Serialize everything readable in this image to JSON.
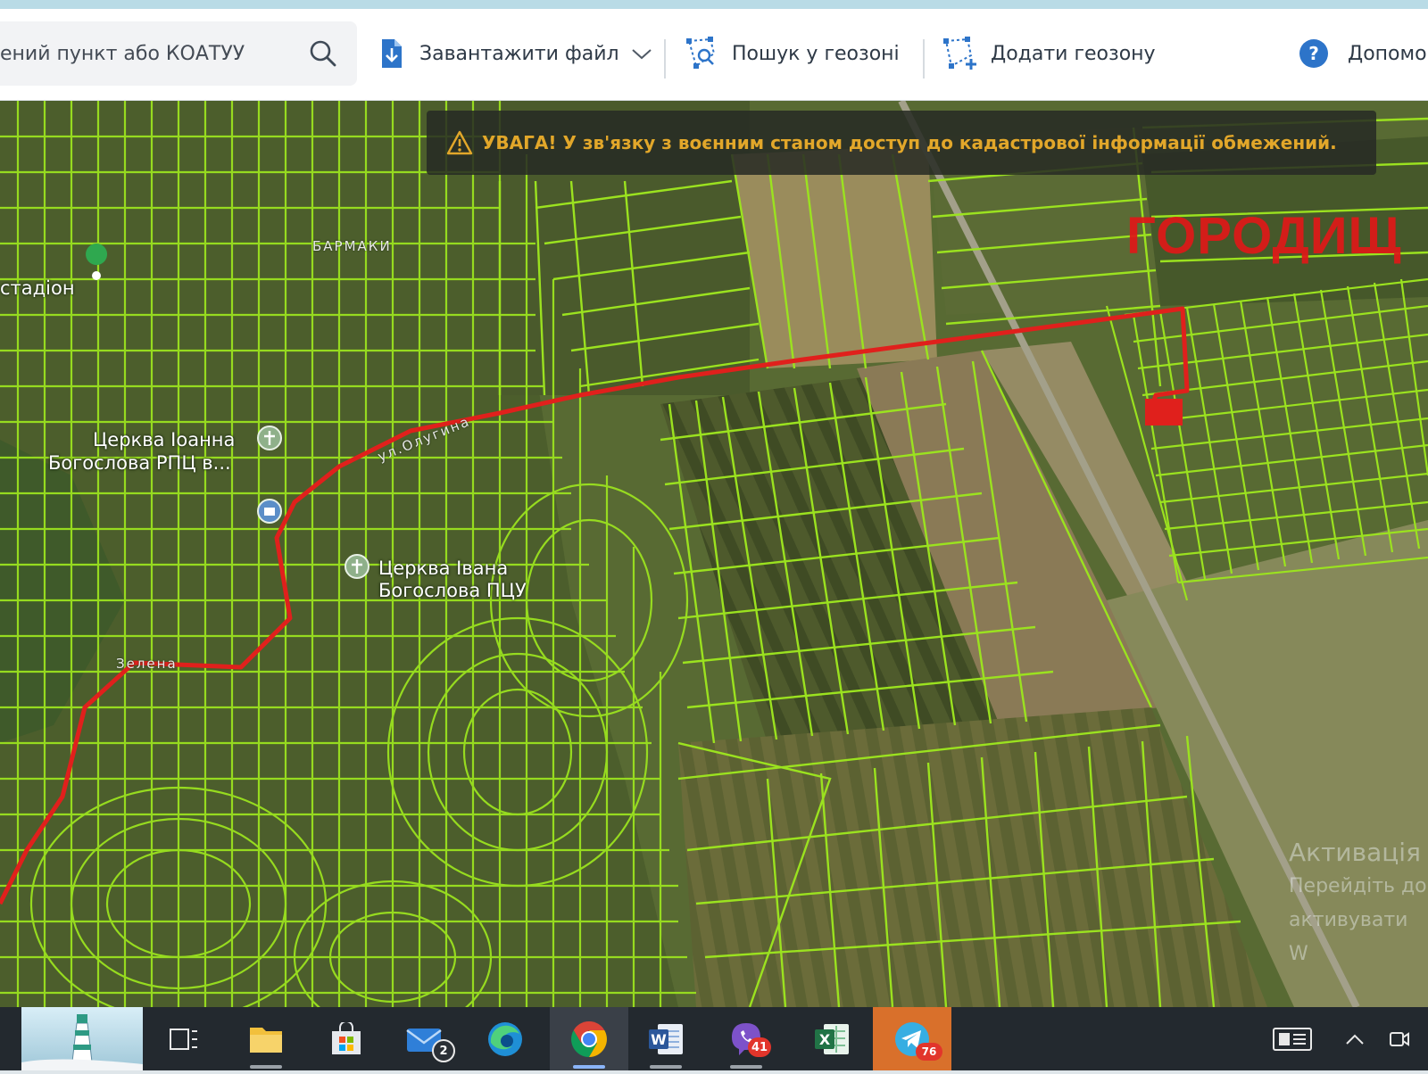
{
  "toolbar": {
    "search_placeholder": "ений пункт або КОАТУУ",
    "download_label": "Завантажити файл",
    "geozone_search_label": "Пошук у геозоні",
    "add_geozone_label": "Додати геозону",
    "help_label": "Допомо"
  },
  "warning": {
    "text": "УВАГА! У зв'язку з воєнним станом доступ до кадастрової інформації обмежений."
  },
  "map_labels": {
    "village": "ГОРОДИЩ",
    "street_1": "БАРМАКИ",
    "street_2": "ул.Олугина",
    "street_3": "Зелена",
    "stadium": "стадіон",
    "church_1_line1": "Церква Іоанна",
    "church_1_line2": "Богослова РПЦ в...",
    "church_2_line1": "Церква Івана",
    "church_2_line2": "Богослова ПЦУ"
  },
  "watermark": {
    "line1": "Активація",
    "line2": "Перейдіть до",
    "line3": "активувати W"
  },
  "taskbar": {
    "apps": [
      {
        "name": "task-view",
        "icon": "task-view-icon"
      },
      {
        "name": "file-explorer",
        "icon": "folder-icon"
      },
      {
        "name": "microsoft-store",
        "icon": "store-icon"
      },
      {
        "name": "mail",
        "icon": "mail-icon",
        "badge": "2"
      },
      {
        "name": "edge",
        "icon": "edge-icon"
      },
      {
        "name": "chrome",
        "icon": "chrome-icon"
      },
      {
        "name": "word",
        "icon": "word-icon"
      },
      {
        "name": "viber",
        "icon": "viber-icon",
        "badge": "41"
      },
      {
        "name": "excel",
        "icon": "excel-icon"
      },
      {
        "name": "telegram",
        "icon": "telegram-icon",
        "badge": "76"
      }
    ],
    "mail_badge": "2",
    "viber_badge": "41",
    "telegram_badge": "76"
  },
  "colors": {
    "parcel_outline": "#9be21f",
    "route": "#e0201c",
    "warning_text": "#e2a72a",
    "satellite_base": "#55652f"
  }
}
